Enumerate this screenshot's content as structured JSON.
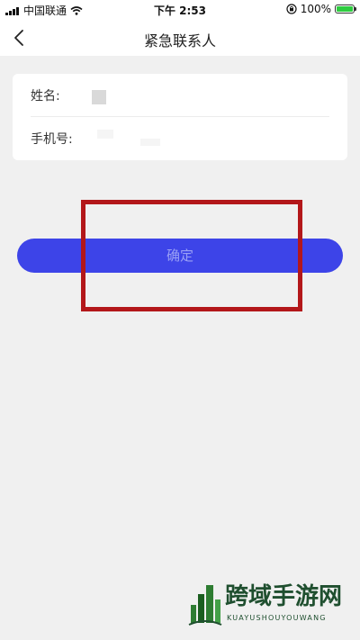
{
  "status_bar": {
    "carrier": "中国联通",
    "time": "下午 2:53",
    "battery": "100%",
    "icons": [
      "signal-icon",
      "wifi-icon",
      "orientation-lock-icon",
      "battery-icon"
    ]
  },
  "nav": {
    "back_icon": "chevron-left-icon",
    "title": "紧急联系人"
  },
  "form": {
    "name_label": "姓名:",
    "phone_label": "手机号:"
  },
  "confirm_button": {
    "label": "确定"
  },
  "colors": {
    "button_bg": "#3d44e8",
    "button_text": "#9aa0f5",
    "highlight": "#b3171a",
    "page_bg": "#f0f0f0"
  },
  "watermark": {
    "cn": "跨域手游网",
    "en": "KUAYUSHOUYOUWANG"
  }
}
